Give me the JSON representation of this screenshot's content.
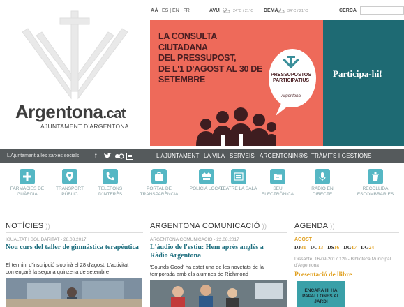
{
  "utility": {
    "text_size": "AÅ",
    "languages": "ES | EN | FR",
    "today_label": "AVUI",
    "today_temp": "24°C / 21°C",
    "tomorrow_label": "DEMÀ",
    "tomorrow_temp": "34°C / 21°C",
    "search_label": "CERCA",
    "search_value": ""
  },
  "logo": {
    "name": "Argentona",
    "tld": ".cat",
    "subtitle": "AJUNTAMENT D'ARGENTONA"
  },
  "banner": {
    "title_lines": [
      "LA CONSULTA CIUTADANA",
      "DEL PRESSUPOST,",
      "DE L'1 D'AGOST AL 30 DE",
      "SETEMBRE"
    ],
    "bubble_text": "PRESSUPOSTOS PARTICIPATIUS",
    "bubble_sign": "Argentona",
    "cta": "Participa-hi!",
    "colors": {
      "coral": "#ee6a5a",
      "teal": "#1e6a73"
    }
  },
  "nav": {
    "social_label": "L'Ajuntament a les xarxes socials",
    "items": [
      "L'AJUNTAMENT",
      "LA VILA",
      "SERVEIS",
      "ARGENTONIN@S",
      "TRÀMITS I GESTIONS"
    ]
  },
  "quick_links": [
    {
      "label": "FARMÀCIES DE GUÀRDIA",
      "icon": "plus-icon"
    },
    {
      "label": "TRANSPORT PÚBLIC",
      "icon": "map-pin-icon"
    },
    {
      "label": "TELÈFONS D'INTERÈS",
      "icon": "phone-icon"
    },
    {
      "label": "PORTAL DE TRANSPARÈNCIA",
      "icon": "briefcase-icon"
    },
    {
      "label": "POLICIA LOCAL",
      "icon": "police-icon"
    },
    {
      "label": "TEATRE LA SALA",
      "icon": "theatre-icon"
    },
    {
      "label": "SEU ELECTRÒNICA",
      "icon": "folder-icon"
    },
    {
      "label": "RÀDIO EN DIRECTE",
      "icon": "microphone-icon"
    },
    {
      "label": "RECOLLIDA ESCOMBRARIES",
      "icon": "bin-icon"
    }
  ],
  "news": {
    "title": "NOTÍCIES",
    "meta": "IGUALTAT I SOLIDARITAT - 28.08.2017",
    "headline": "Nou curs del taller de gimnàstica terapèutica",
    "summary": "El termini d'inscripció s'obrirà el 28 d'agost. L'activitat començarà la segona quinzena de setembre"
  },
  "comms": {
    "title": "ARGENTONA COMUNICACIÓ",
    "meta": "ARGENTONA COMUNICACIÓ - 22.08.2017",
    "headline": "L'àudio de l'estiu: Hem après anglès a Ràdio Argentona",
    "summary": "'Sounds Good' ha estat una de les novetats de la temporada amb els alumnes de Richmond"
  },
  "agenda": {
    "title": "AGENDA",
    "month": "AGOST",
    "days": [
      {
        "d": "DJ",
        "n": "31"
      },
      {
        "d": "DC",
        "n": "13"
      },
      {
        "d": "DS",
        "n": "16"
      },
      {
        "d": "DG",
        "n": "17"
      },
      {
        "d": "DG",
        "n": "24"
      }
    ],
    "event_meta": "Dissabte, 16-09-2017 12h - Biblioteca Municipal d'Argentona",
    "event_title": "Presentació de llibre",
    "poster_text": "ENCARA HI HA PAPALLONES AL JARDÍ"
  }
}
